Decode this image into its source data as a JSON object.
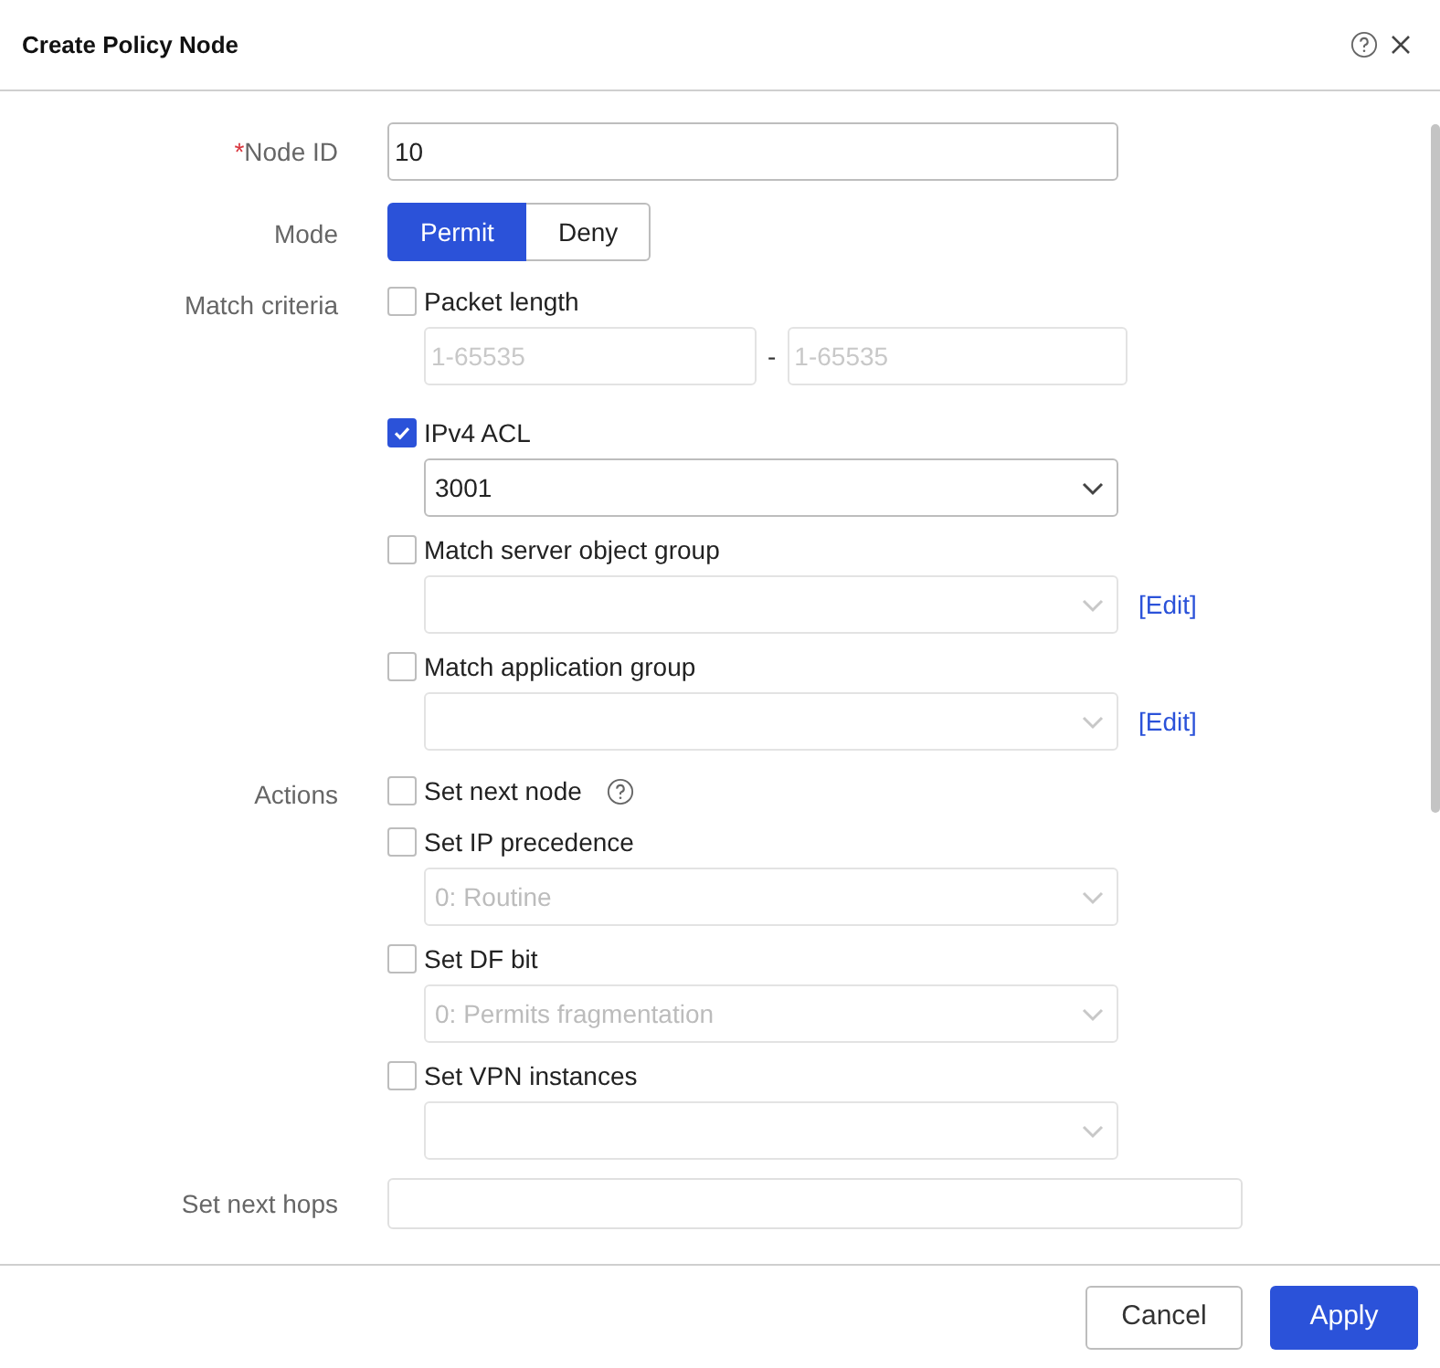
{
  "window": {
    "title": "Create Policy Node"
  },
  "node_id": {
    "label": "Node ID",
    "required_mark": "*",
    "value": "10"
  },
  "mode": {
    "label": "Mode",
    "options": [
      {
        "label": "Permit",
        "selected": true
      },
      {
        "label": "Deny",
        "selected": false
      }
    ]
  },
  "match_criteria": {
    "label": "Match criteria",
    "items": [
      {
        "kind": "range",
        "label": "Packet length",
        "checked": false,
        "placeholders": [
          "1-65535",
          "1-65535"
        ],
        "separator": "-"
      },
      {
        "kind": "select",
        "label": "IPv4 ACL",
        "checked": true,
        "value": "3001",
        "disabled": false
      },
      {
        "kind": "select",
        "label": "Match server object group",
        "checked": false,
        "disabled": true,
        "link": "[Edit]"
      },
      {
        "kind": "select",
        "label": "Match application group",
        "checked": false,
        "disabled": true,
        "link": "[Edit]"
      }
    ]
  },
  "actions": {
    "label": "Actions",
    "items": [
      {
        "kind": "help",
        "label": "Set next node",
        "checked": false
      },
      {
        "kind": "select",
        "label": "Set IP precedence",
        "checked": false,
        "value": "0: Routine",
        "disabled": true
      },
      {
        "kind": "select",
        "label": "Set DF bit",
        "checked": false,
        "value": "0: Permits fragmentation",
        "disabled": true
      },
      {
        "kind": "select",
        "label": "Set VPN instances",
        "checked": false,
        "disabled": true
      }
    ]
  },
  "next_hops": {
    "label": "Set next hops"
  },
  "buttons": [
    {
      "label": "Cancel",
      "kind": "secondary"
    },
    {
      "label": "Apply",
      "kind": "primary"
    }
  ]
}
